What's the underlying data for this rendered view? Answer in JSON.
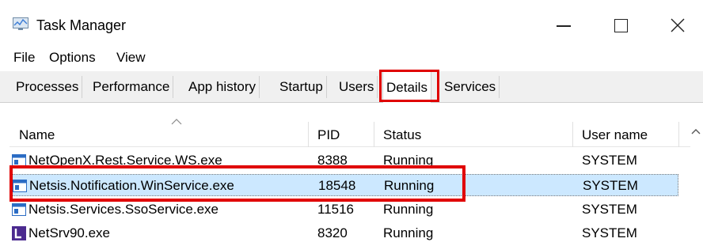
{
  "window": {
    "title": "Task Manager",
    "app_icon": "task-manager-icon",
    "controls": [
      "minimize-icon",
      "maximize-icon",
      "close-icon"
    ]
  },
  "menu": {
    "items": [
      {
        "label": "File"
      },
      {
        "label": "Options"
      },
      {
        "label": "View"
      }
    ]
  },
  "tabs": [
    {
      "label": "Processes"
    },
    {
      "label": "Performance"
    },
    {
      "label": "App history"
    },
    {
      "label": "Startup"
    },
    {
      "label": "Users"
    },
    {
      "label": "Details",
      "active": true
    },
    {
      "label": "Services"
    }
  ],
  "table": {
    "columns": [
      "Name",
      "PID",
      "Status",
      "User name"
    ],
    "sort_indicator": "chevron-up-icon",
    "rows": [
      {
        "name": "NetOpenX.Rest.Service.WS.exe",
        "pid": "8388",
        "status": "Running",
        "user": "SYSTEM",
        "icon": "service-icon"
      },
      {
        "name": "Netsis.Notification.WinService.exe",
        "pid": "18548",
        "status": "Running",
        "user": "SYSTEM",
        "icon": "service-icon",
        "selected": true
      },
      {
        "name": "Netsis.Services.SsoService.exe",
        "pid": "11516",
        "status": "Running",
        "user": "SYSTEM",
        "icon": "service-icon"
      },
      {
        "name": "NetSrv90.exe",
        "pid": "8320",
        "status": "Running",
        "user": "SYSTEM",
        "icon": "netsrv-icon"
      }
    ]
  },
  "colors": {
    "highlight": "#e00000",
    "selection": "#cce8ff",
    "service_icon": "#2b6cc4",
    "netsrv_icon": "#4b2a8f"
  }
}
